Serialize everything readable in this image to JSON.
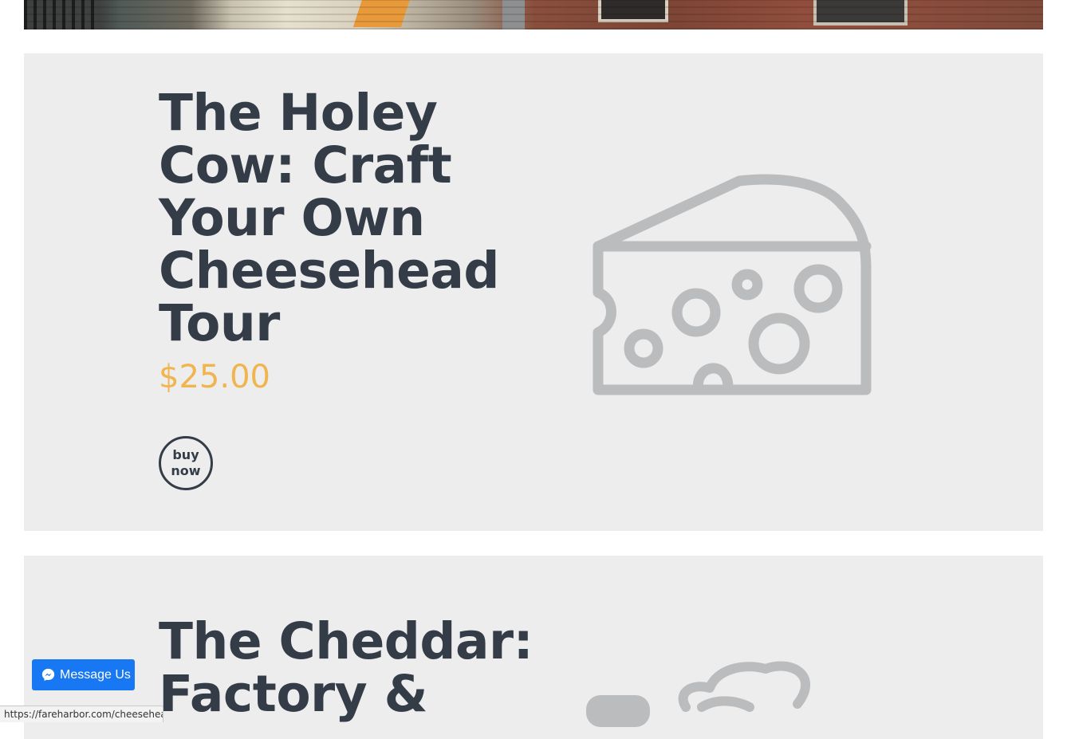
{
  "tours": [
    {
      "title": "The Holey Cow: Craft Your Own Cheesehead Tour",
      "price": "$25.00",
      "buy_label": "buy\nnow",
      "icon": "cheese-wedge-icon"
    },
    {
      "title": "The Cheddar: Factory &",
      "icon": "cheese-product-icon"
    }
  ],
  "messenger": {
    "label": "Message Us",
    "icon": "messenger-icon"
  },
  "status_bar": {
    "url": "https://fareharbor.com/cheesehead/"
  },
  "colors": {
    "card_bg": "#ededed",
    "title": "#343c48",
    "price": "#f0b54e",
    "icon_gray": "#bbbcbe",
    "messenger_blue": "#1877f2"
  }
}
